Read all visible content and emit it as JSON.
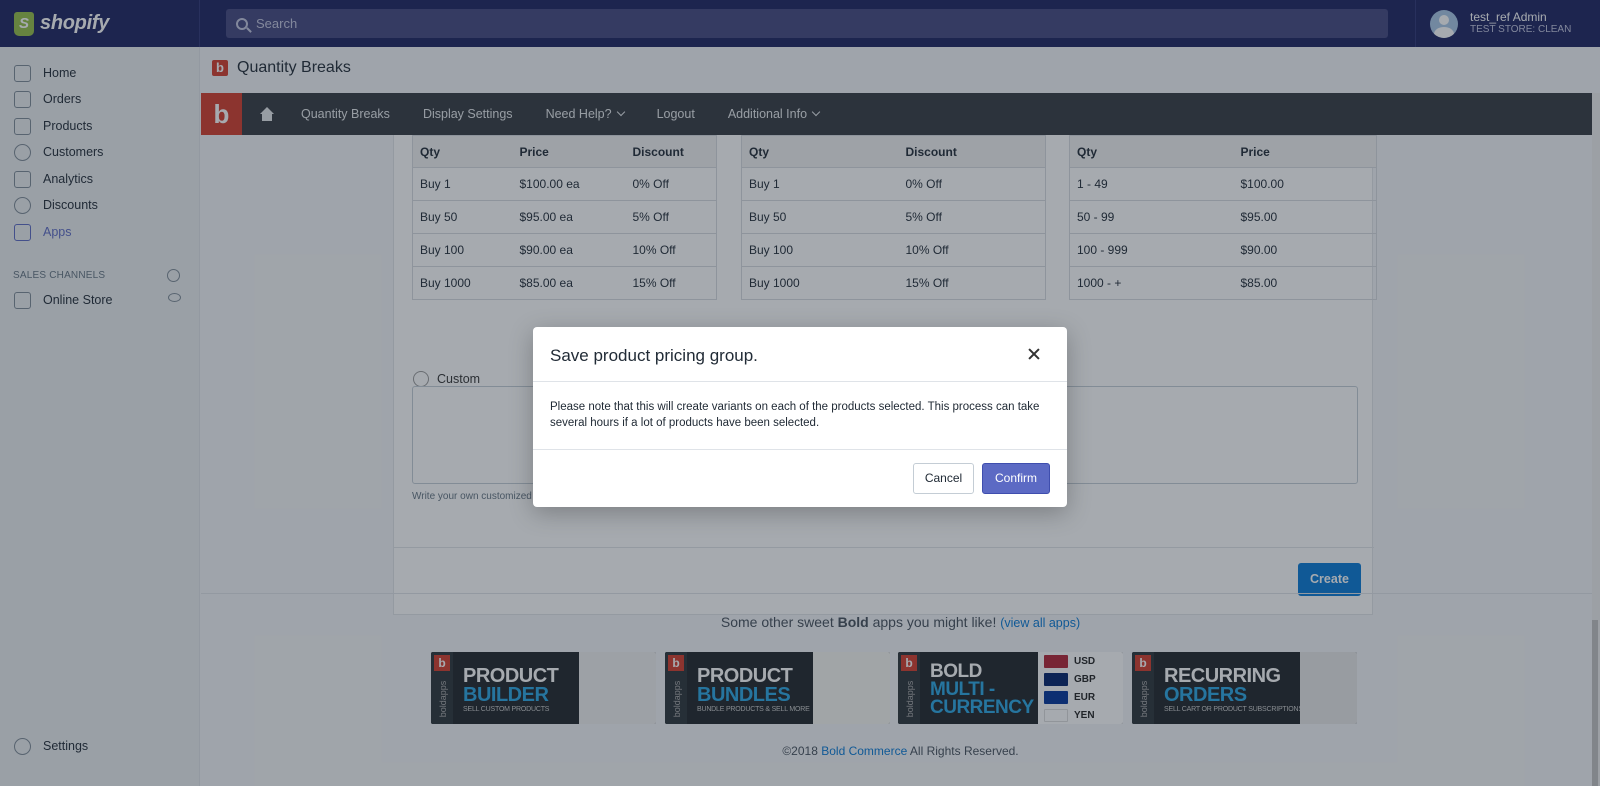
{
  "brand": {
    "name": "shopify"
  },
  "search": {
    "placeholder": "Search"
  },
  "user": {
    "name": "test_ref Admin",
    "store": "TEST STORE: CLEAN"
  },
  "sidebar": {
    "items": [
      {
        "label": "Home",
        "icon": "home-icon"
      },
      {
        "label": "Orders",
        "icon": "orders-icon"
      },
      {
        "label": "Products",
        "icon": "tag-icon"
      },
      {
        "label": "Customers",
        "icon": "person-icon"
      },
      {
        "label": "Analytics",
        "icon": "bar-chart-icon"
      },
      {
        "label": "Discounts",
        "icon": "discount-icon"
      },
      {
        "label": "Apps",
        "icon": "apps-icon",
        "active": true
      }
    ],
    "sales_channels_heading": "SALES CHANNELS",
    "online_store": "Online Store",
    "settings": "Settings"
  },
  "app": {
    "title": "Quantity Breaks",
    "nav": {
      "quantity_breaks": "Quantity Breaks",
      "display_settings": "Display Settings",
      "need_help": "Need Help?",
      "logout": "Logout",
      "additional_info": "Additional Info"
    }
  },
  "tables": [
    {
      "headers": [
        "Qty",
        "Price",
        "Discount"
      ],
      "rows": [
        [
          "Buy 1",
          "$100.00 ea",
          "0% Off"
        ],
        [
          "Buy 50",
          "$95.00 ea",
          "5% Off"
        ],
        [
          "Buy 100",
          "$90.00 ea",
          "10% Off"
        ],
        [
          "Buy 1000",
          "$85.00 ea",
          "15% Off"
        ]
      ]
    },
    {
      "headers": [
        "Qty",
        "Discount"
      ],
      "rows": [
        [
          "Buy 1",
          "0% Off"
        ],
        [
          "Buy 50",
          "5% Off"
        ],
        [
          "Buy 100",
          "10% Off"
        ],
        [
          "Buy 1000",
          "15% Off"
        ]
      ]
    },
    {
      "headers": [
        "Qty",
        "Price"
      ],
      "rows": [
        [
          "1 - 49",
          "$100.00"
        ],
        [
          "50 - 99",
          "$95.00"
        ],
        [
          "100 - 999",
          "$90.00"
        ],
        [
          "1000 - +",
          "$85.00"
        ]
      ]
    }
  ],
  "custom": {
    "label": "Custom",
    "hint": "Write your own customized"
  },
  "create_button": "Create",
  "promo": {
    "text_before": "Some other sweet ",
    "bold": "Bold",
    "text_after": " apps you might like! ",
    "link": "(view all apps)",
    "banners": [
      {
        "line1": "PRODUCT",
        "line2": "BUILDER",
        "sub": "SELL CUSTOM PRODUCTS"
      },
      {
        "line1": "PRODUCT",
        "line2": "BUNDLES",
        "sub": "BUNDLE PRODUCTS & SELL MORE"
      },
      {
        "line1": "BOLD",
        "line2": "MULTI -",
        "line3": "CURRENCY",
        "currencies": [
          "USD",
          "GBP",
          "EUR",
          "YEN"
        ]
      },
      {
        "line1": "RECURRING",
        "line2": "ORDERS",
        "sub": "SELL CART OR PRODUCT SUBSCRIPTIONS"
      }
    ],
    "side_label": "boldapps"
  },
  "copyright": {
    "before": "©2018 ",
    "link": "Bold Commerce",
    "after": " All Rights Reserved."
  },
  "modal": {
    "title": "Save product pricing group.",
    "body": "Please note that this will create variants on each of the products selected. This process can take several hours if a lot of products have been selected.",
    "cancel": "Cancel",
    "confirm": "Confirm"
  },
  "colors": {
    "topbar": "#1c2260",
    "accent": "#5c6ac4",
    "link": "#0678d6",
    "bold_red": "#d43b2a"
  }
}
